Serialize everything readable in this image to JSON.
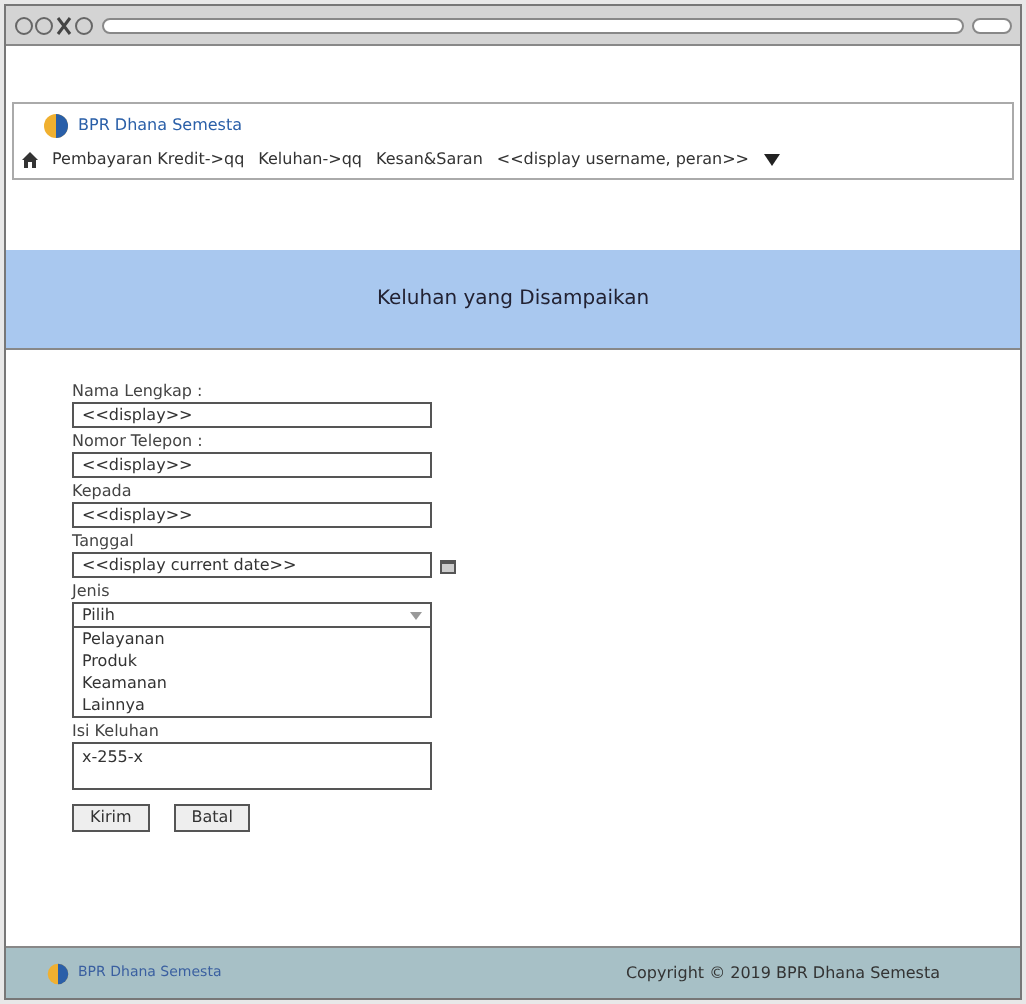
{
  "header": {
    "brand": "BPR Dhana Semesta",
    "nav": [
      {
        "label": "Pembayaran Kredit->qq"
      },
      {
        "label": "Keluhan->qq"
      },
      {
        "label": "Kesan&Saran"
      },
      {
        "label": "<<display username, peran>>"
      }
    ]
  },
  "banner": {
    "title": "Keluhan yang Disampaikan"
  },
  "form": {
    "fields": [
      {
        "kind": "text",
        "label": "Nama Lengkap :",
        "value": "<<display>>"
      },
      {
        "kind": "text",
        "label": "Nomor Telepon :",
        "value": "<<display>>"
      },
      {
        "kind": "text",
        "label": "Kepada",
        "value": "<<display>>"
      },
      {
        "kind": "date",
        "label": "Tanggal",
        "value": "<<display current date>>"
      },
      {
        "kind": "select",
        "label": "Jenis",
        "value": "Pilih",
        "options": [
          "Pelayanan",
          "Produk",
          "Keamanan",
          "Lainnya"
        ]
      },
      {
        "kind": "textarea",
        "label": "Isi Keluhan",
        "value": "x-255-x"
      }
    ],
    "buttons": [
      "Kirim",
      "Batal"
    ]
  },
  "footer": {
    "brand": "BPR Dhana Semesta",
    "copyright": "Copyright © 2019 BPR Dhana Semesta"
  }
}
